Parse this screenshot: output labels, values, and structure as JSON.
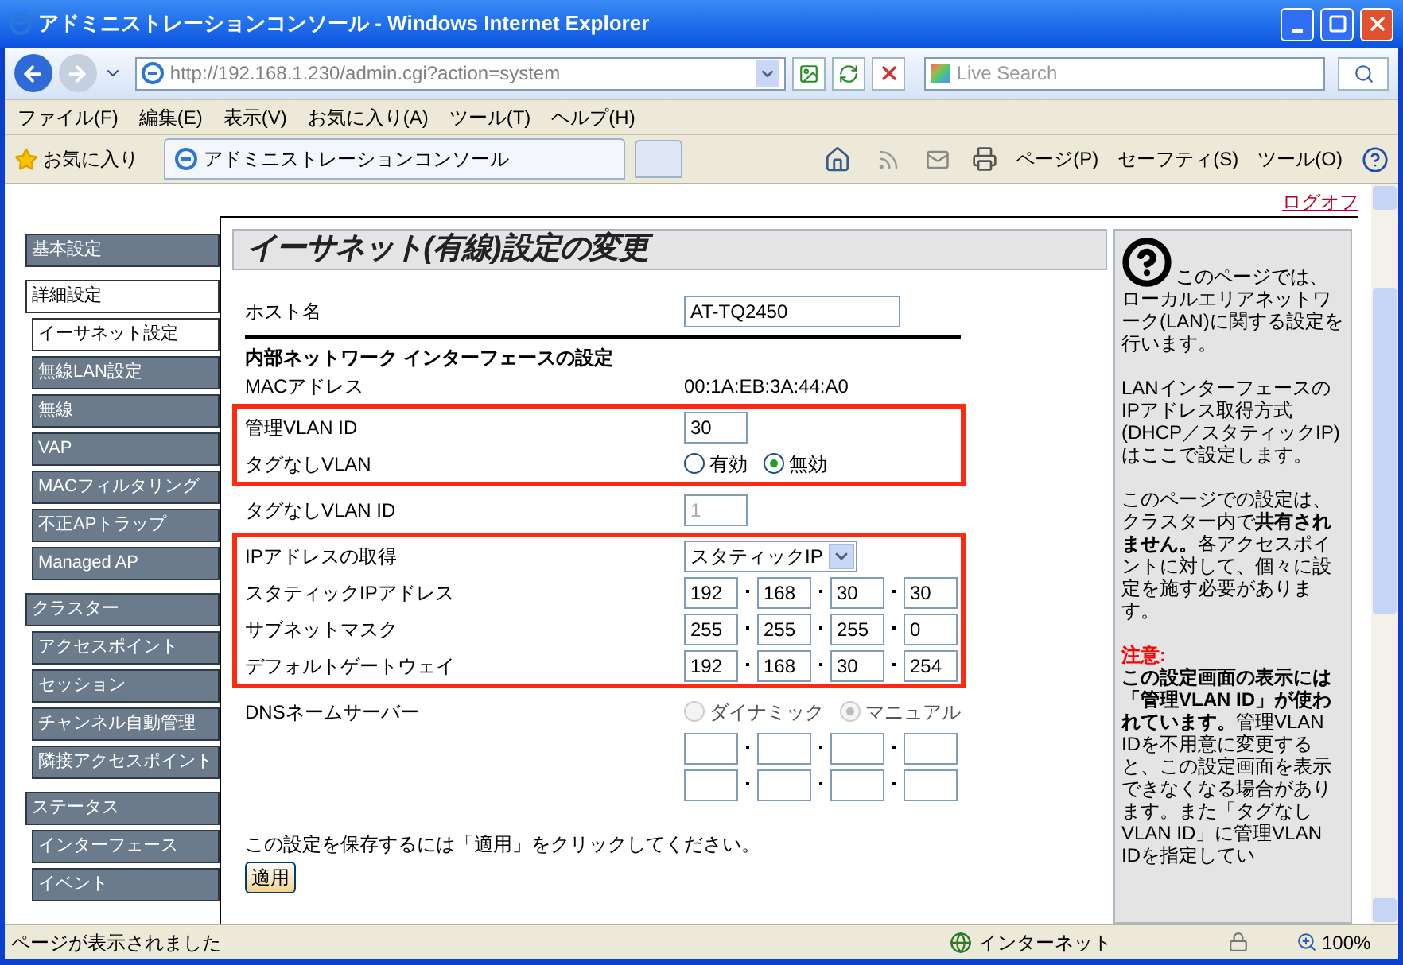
{
  "window": {
    "title": "アドミニストレーションコンソール - Windows Internet Explorer"
  },
  "address": {
    "url": "http://192.168.1.230/admin.cgi?action=system"
  },
  "search": {
    "placeholder": "Live Search"
  },
  "menu": [
    "ファイル(F)",
    "編集(E)",
    "表示(V)",
    "お気に入り(A)",
    "ツール(T)",
    "ヘルプ(H)"
  ],
  "favorites": {
    "label": "お気に入り"
  },
  "tab": {
    "title": "アドミニストレーションコンソール"
  },
  "commands": [
    "ページ(P)",
    "セーフティ(S)",
    "ツール(O)"
  ],
  "logoff": "ログオフ",
  "sidebar": {
    "items": [
      {
        "label": "基本設定",
        "selected": false
      },
      {
        "label": "詳細設定",
        "selected": true,
        "children": [
          {
            "label": "イーサネット設定",
            "selected": true
          },
          {
            "label": "無線LAN設定",
            "selected": false
          },
          {
            "label": "無線",
            "selected": false
          },
          {
            "label": "VAP",
            "selected": false
          },
          {
            "label": "MACフィルタリング",
            "selected": false
          },
          {
            "label": "不正APトラップ",
            "selected": false
          },
          {
            "label": "Managed AP",
            "selected": false
          }
        ]
      },
      {
        "label": "クラスター",
        "selected": false,
        "children": [
          {
            "label": "アクセスポイント",
            "selected": false
          },
          {
            "label": "セッション",
            "selected": false
          },
          {
            "label": "チャンネル自動管理",
            "selected": false
          },
          {
            "label": "隣接アクセスポイント",
            "selected": false
          }
        ]
      },
      {
        "label": "ステータス",
        "selected": false,
        "children": [
          {
            "label": "インターフェース",
            "selected": false
          },
          {
            "label": "イベント",
            "selected": false
          }
        ]
      }
    ]
  },
  "form": {
    "title": "イーサネット(有線)設定の変更",
    "items": [
      {
        "kind": "wide-field",
        "label": "ホスト名",
        "value": "AT-TQ2450"
      },
      {
        "kind": "heading",
        "text": "内部ネットワーク インターフェースの設定"
      },
      {
        "kind": "static",
        "label": "MACアドレス",
        "value": "00:1A:EB:3A:44:A0"
      },
      {
        "kind": "group",
        "highlighted": true,
        "children": [
          {
            "kind": "field",
            "label": "管理VLAN ID",
            "value": "30"
          },
          {
            "kind": "radio",
            "label": "タグなしVLAN",
            "options": [
              {
                "label": "有効",
                "selected": false
              },
              {
                "label": "無効",
                "selected": true
              }
            ]
          }
        ]
      },
      {
        "kind": "field",
        "label": "タグなしVLAN ID",
        "value": "1",
        "disabled": true
      },
      {
        "kind": "group",
        "highlighted": true,
        "children": [
          {
            "kind": "select",
            "label": "IPアドレスの取得",
            "value": "スタティックIP"
          },
          {
            "kind": "ip",
            "label": "スタティックIPアドレス",
            "octets": [
              "192",
              "168",
              "30",
              "30"
            ]
          },
          {
            "kind": "ip",
            "label": "サブネットマスク",
            "octets": [
              "255",
              "255",
              "255",
              "0"
            ]
          },
          {
            "kind": "ip",
            "label": "デフォルトゲートウェイ",
            "octets": [
              "192",
              "168",
              "30",
              "254"
            ]
          }
        ]
      },
      {
        "kind": "radio",
        "label": "DNSネームサーバー",
        "disabled": true,
        "options": [
          {
            "label": "ダイナミック",
            "selected": false
          },
          {
            "label": "マニュアル",
            "selected": true
          }
        ]
      },
      {
        "kind": "ip"
      },
      {
        "kind": "ip"
      }
    ],
    "note": "この設定を保存するには「適用」をクリックしてください。",
    "button": "適用"
  },
  "help": {
    "paragraphs": [
      "このページでは、ローカルエリアネットワーク(LAN)に関する設定を行います。",
      "LANインターフェースのIPアドレス取得方式(DHCP／スタティックIP)はここで設定します。",
      "このページでの設定は、クラスター内で**共有されません。**各アクセスポイントに対して、個々に設定を施す必要があります。"
    ],
    "warning": {
      "label": "注意:",
      "text": "**この設定画面の表示には「管理VLAN ID」が使われています。**管理VLAN IDを不用意に変更すると、この設定画面を表示できなくなる場合があります。また「タグなしVLAN ID」に管理VLAN IDを指定してい"
    }
  },
  "status_bar": {
    "message": "ページが表示されました",
    "zone": "インターネット",
    "zoom": "100%"
  }
}
